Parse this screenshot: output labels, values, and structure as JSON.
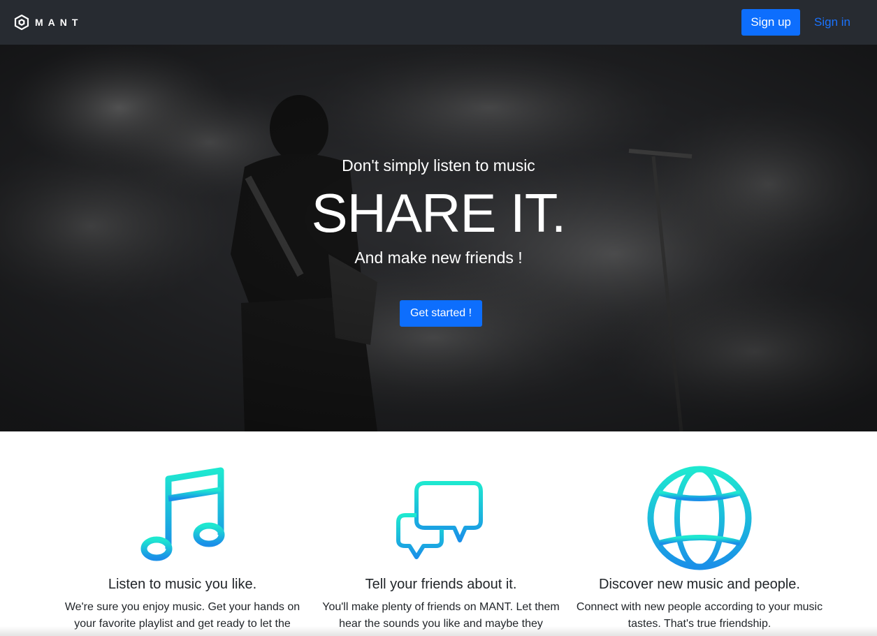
{
  "navbar": {
    "brand": "MANT",
    "brand_icon": "mant-logo-icon",
    "signup_label": "Sign up",
    "signin_label": "Sign in"
  },
  "hero": {
    "tagline": "Don't simply listen to music",
    "title": "SHARE IT.",
    "subtitle": "And make new friends !",
    "cta_label": "Get started !"
  },
  "features": [
    {
      "icon": "music-note-icon",
      "title": "Listen to music you like.",
      "desc": "We're sure you enjoy music. Get your hands on your favorite playlist and get ready to let the"
    },
    {
      "icon": "chat-bubbles-icon",
      "title": "Tell your friends about it.",
      "desc": "You'll make plenty of friends on MANT. Let them hear the sounds you like and maybe they"
    },
    {
      "icon": "globe-icon",
      "title": "Discover new music and people.",
      "desc": "Connect with new people according to your music tastes. That's true friendship."
    }
  ],
  "colors": {
    "navbar_bg": "#272b31",
    "primary": "#0d6efd",
    "icon_gradient_top": "#1ee8d0",
    "icon_gradient_bottom": "#1a8fe8"
  }
}
